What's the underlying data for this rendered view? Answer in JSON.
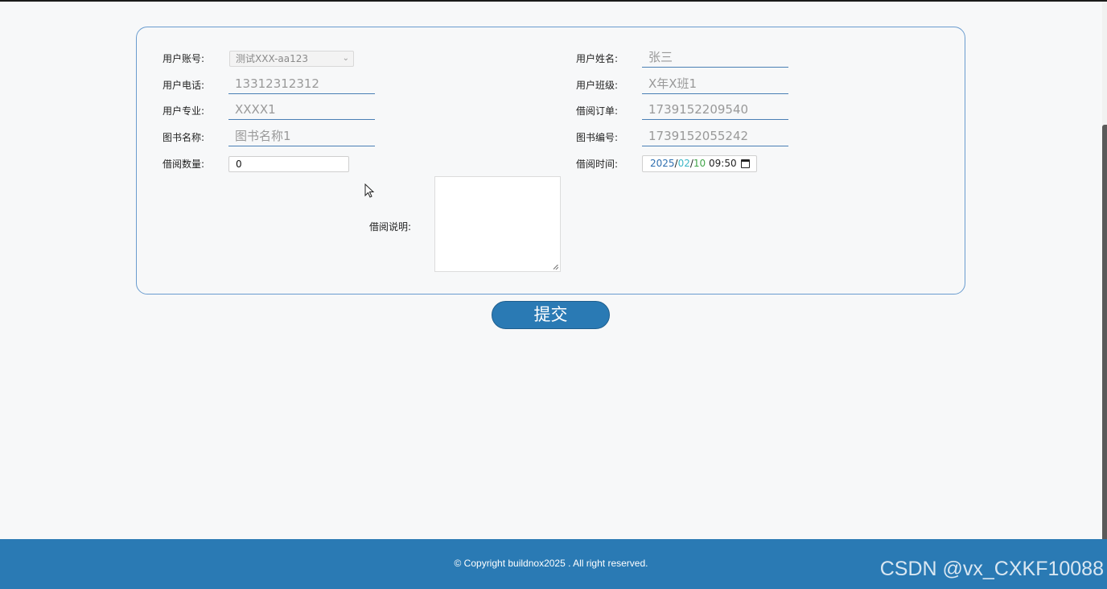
{
  "form": {
    "account_label": "用户账号:",
    "account_value": "测试XXX-aa123",
    "name_label": "用户姓名:",
    "name_value": "张三",
    "phone_label": "用户电话:",
    "phone_value": "13312312312",
    "class_label": "用户班级:",
    "class_value": "X年X班1",
    "major_label": "用户专业:",
    "major_value": "XXXX1",
    "order_label": "借阅订单:",
    "order_value": "1739152209540",
    "book_name_label": "图书名称:",
    "book_name_value": "图书名称1",
    "book_no_label": "图书编号:",
    "book_no_value": "1739152055242",
    "quantity_label": "借阅数量:",
    "quantity_value": "0",
    "time_label": "借阅时间:",
    "time_year": "2025",
    "time_month": "02",
    "time_day": "10",
    "time_clock": "09:50",
    "desc_label": "借阅说明:"
  },
  "submit_label": "提交",
  "footer": {
    "copyright": "© Copyright buildnox2025 . All right reserved.",
    "watermark": "CSDN @vx_CXKF10088"
  },
  "colors": {
    "primary": "#2a7ab4",
    "border": "#6a9ccf",
    "background": "#f7f8f9"
  }
}
